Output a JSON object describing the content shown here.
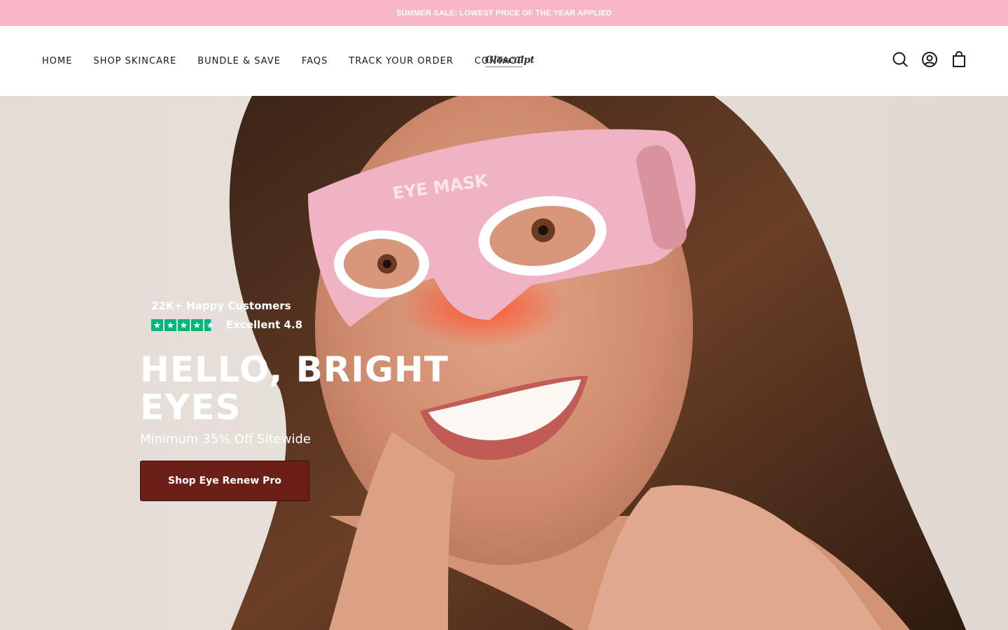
{
  "announcement": {
    "text": "SUMMER SALE: LOWEST PRICE OF THE YEAR APPLIED"
  },
  "header": {
    "nav": [
      "HOME",
      "SHOP SKINCARE",
      "BUNDLE & SAVE",
      "FAQS",
      "TRACK YOUR ORDER",
      "CONTACT"
    ],
    "logo": "Glosculpt",
    "icons": [
      "search-icon",
      "account-icon",
      "cart-icon"
    ]
  },
  "hero": {
    "mask_text": "EYE MASK",
    "customers": "22K+ Happy Customers",
    "rating_text": "Excellent 4.8",
    "stars": 4.5,
    "headline": "HELLO, BRIGHT EYES",
    "subheadline": "Minimum 35% Off Sitewide",
    "cta_label": "Shop Eye Renew Pro"
  },
  "colors": {
    "announcement_bg": "#f7b7c7",
    "cta_bg": "#6b1f17",
    "trustpilot_green": "#00b67a",
    "mask_pink": "#efb3c3"
  }
}
